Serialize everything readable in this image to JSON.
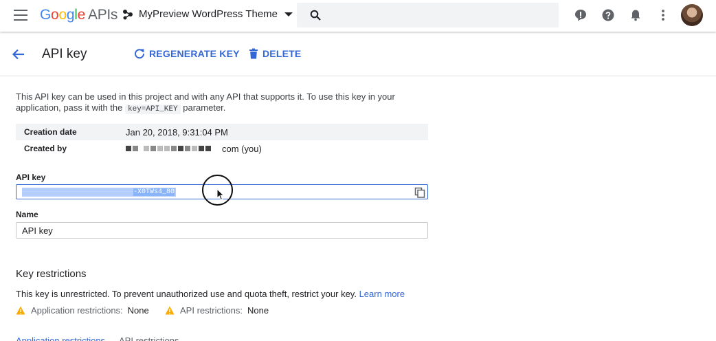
{
  "topbar": {
    "logo_google": "Google",
    "logo_apis": "APIs",
    "project_name": "MyPreview WordPress Theme",
    "search_placeholder": "",
    "icons": [
      "menu-icon",
      "search-icon",
      "feedback-icon",
      "help-icon",
      "notifications-icon",
      "more-vert-icon"
    ]
  },
  "header": {
    "title": "API key",
    "regenerate_label": "REGENERATE KEY",
    "delete_label": "DELETE"
  },
  "description": {
    "before": "This API key can be used in this project and with any API that supports it. To use this key in your application, pass it with the",
    "code": "key=API_KEY",
    "after": "parameter."
  },
  "info": {
    "creation_label": "Creation date",
    "creation_value": "Jan 20, 2018, 9:31:04 PM",
    "created_by_label": "Created by",
    "created_by_suffix": "com (you)"
  },
  "api_key": {
    "label": "API key",
    "visible_tail": "-X0TWs4_80"
  },
  "name_field": {
    "label": "Name",
    "value": "API key"
  },
  "restrictions": {
    "title": "Key restrictions",
    "note": "This key is unrestricted. To prevent unauthorized use and quota theft, restrict your key.",
    "learn_more": "Learn more",
    "app_label": "Application restrictions:",
    "app_value": "None",
    "api_label": "API restrictions:",
    "api_value": "None",
    "tabs": [
      "Application restrictions",
      "API restrictions"
    ]
  },
  "colors": {
    "accent": "#3367d6",
    "warning": "#f9ab00"
  }
}
